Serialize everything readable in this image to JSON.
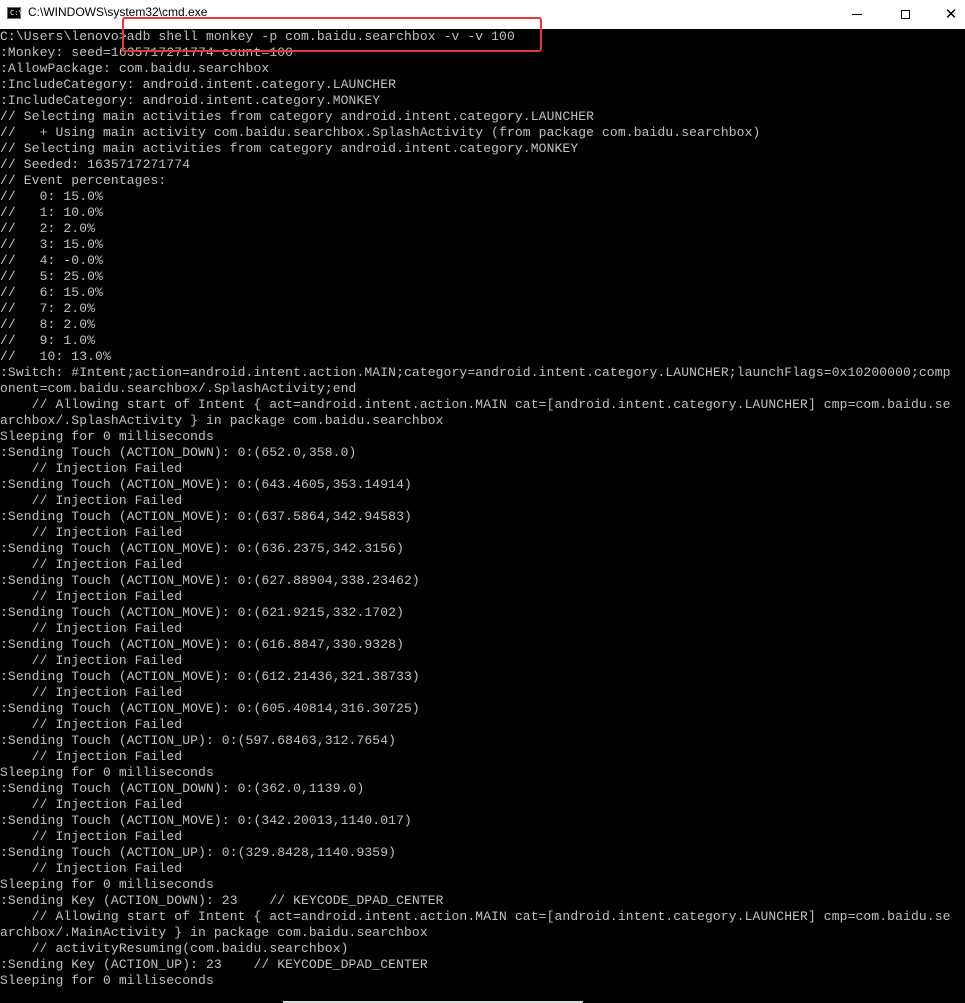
{
  "window": {
    "title": "C:\\WINDOWS\\system32\\cmd.exe",
    "icon": "cmd-console-icon",
    "icon_prompt": "C:\\",
    "controls": {
      "minimize": "minimize-icon",
      "maximize": "maximize-icon",
      "close": "close-icon",
      "close_glyph": "✕"
    }
  },
  "console": {
    "lines": [
      "C:\\Users\\lenovo>adb shell monkey -p com.baidu.searchbox -v -v 100",
      ":Monkey: seed=1635717271774 count=100",
      ":AllowPackage: com.baidu.searchbox",
      ":IncludeCategory: android.intent.category.LAUNCHER",
      ":IncludeCategory: android.intent.category.MONKEY",
      "// Selecting main activities from category android.intent.category.LAUNCHER",
      "//   + Using main activity com.baidu.searchbox.SplashActivity (from package com.baidu.searchbox)",
      "// Selecting main activities from category android.intent.category.MONKEY",
      "// Seeded: 1635717271774",
      "// Event percentages:",
      "//   0: 15.0%",
      "//   1: 10.0%",
      "//   2: 2.0%",
      "//   3: 15.0%",
      "//   4: -0.0%",
      "//   5: 25.0%",
      "//   6: 15.0%",
      "//   7: 2.0%",
      "//   8: 2.0%",
      "//   9: 1.0%",
      "//   10: 13.0%",
      ":Switch: #Intent;action=android.intent.action.MAIN;category=android.intent.category.LAUNCHER;launchFlags=0x10200000;comp",
      "onent=com.baidu.searchbox/.SplashActivity;end",
      "    // Allowing start of Intent { act=android.intent.action.MAIN cat=[android.intent.category.LAUNCHER] cmp=com.baidu.se",
      "archbox/.SplashActivity } in package com.baidu.searchbox",
      "Sleeping for 0 milliseconds",
      ":Sending Touch (ACTION_DOWN): 0:(652.0,358.0)",
      "    // Injection Failed",
      ":Sending Touch (ACTION_MOVE): 0:(643.4605,353.14914)",
      "    // Injection Failed",
      ":Sending Touch (ACTION_MOVE): 0:(637.5864,342.94583)",
      "    // Injection Failed",
      ":Sending Touch (ACTION_MOVE): 0:(636.2375,342.3156)",
      "    // Injection Failed",
      ":Sending Touch (ACTION_MOVE): 0:(627.88904,338.23462)",
      "    // Injection Failed",
      ":Sending Touch (ACTION_MOVE): 0:(621.9215,332.1702)",
      "    // Injection Failed",
      ":Sending Touch (ACTION_MOVE): 0:(616.8847,330.9328)",
      "    // Injection Failed",
      ":Sending Touch (ACTION_MOVE): 0:(612.21436,321.38733)",
      "    // Injection Failed",
      ":Sending Touch (ACTION_MOVE): 0:(605.40814,316.30725)",
      "    // Injection Failed",
      ":Sending Touch (ACTION_UP): 0:(597.68463,312.7654)",
      "    // Injection Failed",
      "Sleeping for 0 milliseconds",
      ":Sending Touch (ACTION_DOWN): 0:(362.0,1139.0)",
      "    // Injection Failed",
      ":Sending Touch (ACTION_MOVE): 0:(342.20013,1140.017)",
      "    // Injection Failed",
      ":Sending Touch (ACTION_UP): 0:(329.8428,1140.9359)",
      "    // Injection Failed",
      "Sleeping for 0 milliseconds",
      ":Sending Key (ACTION_DOWN): 23    // KEYCODE_DPAD_CENTER",
      "    // Allowing start of Intent { act=android.intent.action.MAIN cat=[android.intent.category.LAUNCHER] cmp=com.baidu.se",
      "archbox/.MainActivity } in package com.baidu.searchbox",
      "    // activityResuming(com.baidu.searchbox)",
      ":Sending Key (ACTION_UP): 23    // KEYCODE_DPAD_CENTER",
      "Sleeping for 0 milliseconds"
    ]
  },
  "annotation": {
    "color": "#e53935",
    "target": "adb shell monkey -p com.baidu.searchbox -v -v 100"
  }
}
